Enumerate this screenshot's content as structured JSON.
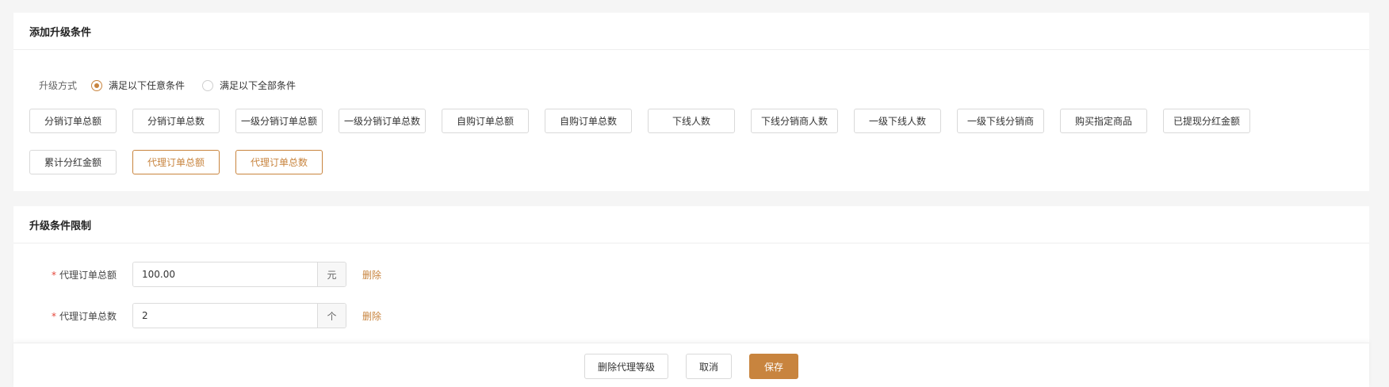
{
  "conditions_card": {
    "title": "添加升级条件",
    "mode_label": "升级方式",
    "modes": [
      {
        "label": "满足以下任意条件",
        "checked": true
      },
      {
        "label": "满足以下全部条件",
        "checked": false
      }
    ],
    "buttons": [
      {
        "label": "分销订单总额",
        "active": false
      },
      {
        "label": "分销订单总数",
        "active": false
      },
      {
        "label": "一级分销订单总额",
        "active": false
      },
      {
        "label": "一级分销订单总数",
        "active": false
      },
      {
        "label": "自购订单总额",
        "active": false
      },
      {
        "label": "自购订单总数",
        "active": false
      },
      {
        "label": "下线人数",
        "active": false
      },
      {
        "label": "下线分销商人数",
        "active": false
      },
      {
        "label": "一级下线人数",
        "active": false
      },
      {
        "label": "一级下线分销商",
        "active": false
      },
      {
        "label": "购买指定商品",
        "active": false
      },
      {
        "label": "已提现分红金额",
        "active": false
      },
      {
        "label": "累计分红金额",
        "active": false
      },
      {
        "label": "代理订单总额",
        "active": true
      },
      {
        "label": "代理订单总数",
        "active": true
      }
    ]
  },
  "limits_card": {
    "title": "升级条件限制",
    "rows": [
      {
        "required_mark": "*",
        "label": "代理订单总额",
        "value": "100.00",
        "unit": "元",
        "delete_label": "删除"
      },
      {
        "required_mark": "*",
        "label": "代理订单总数",
        "value": "2",
        "unit": "个",
        "delete_label": "删除"
      }
    ]
  },
  "footer": {
    "delete_level_label": "删除代理等级",
    "cancel_label": "取消",
    "save_label": "保存"
  },
  "colors": {
    "accent": "#c8843e",
    "required": "#e5473b"
  }
}
